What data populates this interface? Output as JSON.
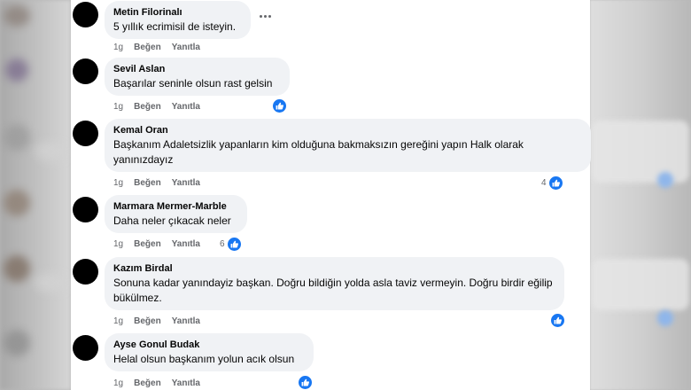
{
  "actions": {
    "time": "1g",
    "like": "Beğen",
    "reply": "Yanıtla"
  },
  "comments": [
    {
      "author": "Metin Filorinalı",
      "text": "5 yıllık ecrimisil de isteyin.",
      "likes": ""
    },
    {
      "author": "Sevil Aslan",
      "text": "Başarılar seninle olsun rast gelsin",
      "likes": ""
    },
    {
      "author": "Kemal Oran",
      "text": "Başkanım Adaletsizlik yapanların kim olduğuna bakmaksızın gereğini yapın Halk olarak yanınızdayız",
      "likes": "4"
    },
    {
      "author": "Marmara Mermer-Marble",
      "text": "Daha neler çıkacak neler",
      "likes": "6"
    },
    {
      "author": "Kazım Birdal",
      "text": "Sonuna kadar yanındayiz başkan. Doğru bildiğin yolda asla taviz vermeyin. Doğru birdir eğilip bükülmez.",
      "likes": ""
    },
    {
      "author": "Ayse Gonul Budak",
      "text": "Helal olsun başkanım yolun acık olsun",
      "likes": ""
    }
  ],
  "colors": {
    "accent": "#1877f2",
    "bubble": "#f0f2f5",
    "meta": "#65676b"
  }
}
